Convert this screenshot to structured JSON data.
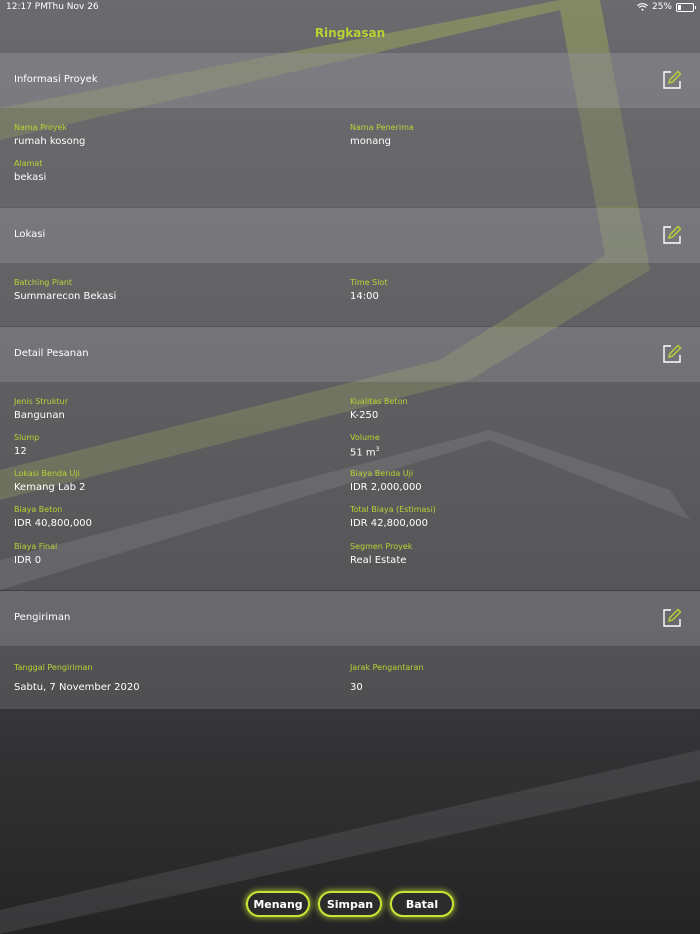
{
  "status_bar": {
    "time": "12:17 PM",
    "date": "Thu Nov 26",
    "battery": "25%"
  },
  "title": "Ringkasan",
  "sections": {
    "informasi_proyek": {
      "title": "Informasi Proyek",
      "nama_proyek": {
        "label": "Nama Proyek",
        "value": "rumah kosong"
      },
      "nama_penerima": {
        "label": "Nama Penerima",
        "value": "monang"
      },
      "alamat": {
        "label": "Alamat",
        "value": "bekasi"
      }
    },
    "lokasi": {
      "title": "Lokasi",
      "batching_plant": {
        "label": "Batching Plant",
        "value": "Summarecon Bekasi"
      },
      "time_slot": {
        "label": "Time Slot",
        "value": "14:00"
      }
    },
    "detail_pesanan": {
      "title": "Detail Pesanan",
      "jenis_struktur": {
        "label": "Jenis Struktur",
        "value": "Bangunan"
      },
      "kualitas_beton": {
        "label": "Kualitas Beton",
        "value": "K-250"
      },
      "slump": {
        "label": "Slump",
        "value": "12"
      },
      "volume": {
        "label": "Volume",
        "value": "51 m",
        "unit_sup": "3"
      },
      "lokasi_benda_uji": {
        "label": "Lokasi Benda Uji",
        "value": "Kemang Lab 2"
      },
      "biaya_benda_uji": {
        "label": "Biaya Benda Uji",
        "value": "IDR 2,000,000"
      },
      "biaya_beton": {
        "label": "Biaya Beton",
        "value": "IDR 40,800,000"
      },
      "total_biaya": {
        "label": "Total Biaya (Estimasi)",
        "value": "IDR 42,800,000"
      },
      "biaya_final": {
        "label": "Biaya Final",
        "value": "IDR 0"
      },
      "segmen_proyek": {
        "label": "Segmen Proyek",
        "value": "Real Estate"
      }
    },
    "pengiriman": {
      "title": "Pengiriman",
      "tanggal_pengiriman": {
        "label": "Tanggal Pengiriman",
        "value": "Sabtu, 7 November 2020"
      },
      "jarak_pengantaran": {
        "label": "Jarak Pengantaran",
        "value": "30"
      }
    }
  },
  "buttons": {
    "menang": "Menang",
    "simpan": "Simpan",
    "batal": "Batal"
  },
  "colors": {
    "accent": "#b6d334",
    "button_glow": "#c8e534"
  }
}
